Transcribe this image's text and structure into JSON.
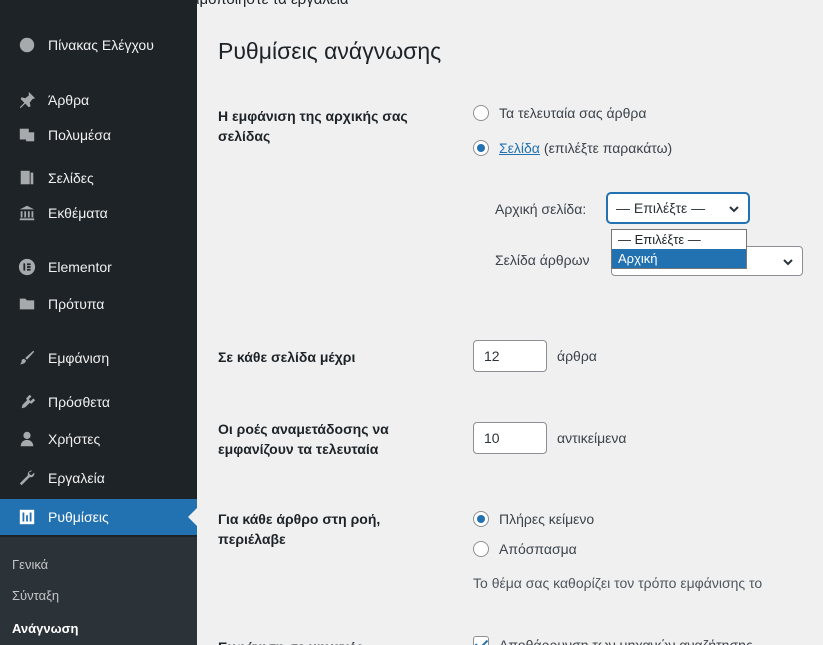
{
  "top_hint": "Χρησιμοποιήστε τα εργαλεία",
  "sidebar": {
    "items": [
      {
        "label": "Πίνακας Ελέγχου",
        "icon": "dashboard-icon"
      },
      {
        "label": "Άρθρα",
        "icon": "pin-icon"
      },
      {
        "label": "Πολυμέσα",
        "icon": "media-icon"
      },
      {
        "label": "Σελίδες",
        "icon": "page-icon"
      },
      {
        "label": "Εκθέματα",
        "icon": "bank-icon"
      },
      {
        "label": "Elementor",
        "icon": "elementor-icon"
      },
      {
        "label": "Πρότυπα",
        "icon": "folder-icon"
      },
      {
        "label": "Εμφάνιση",
        "icon": "brush-icon"
      },
      {
        "label": "Πρόσθετα",
        "icon": "plugin-icon"
      },
      {
        "label": "Χρήστες",
        "icon": "users-icon"
      },
      {
        "label": "Εργαλεία",
        "icon": "wrench-icon"
      },
      {
        "label": "Ρυθμίσεις",
        "icon": "settings-icon"
      }
    ],
    "submenu": [
      "Γενικά",
      "Σύνταξη",
      "Ανάγνωση"
    ]
  },
  "page": {
    "title": "Ρυθμίσεις ανάγνωσης",
    "homepage": {
      "label": "Η εμφάνιση της αρχικής σας σελίδας",
      "option_latest": "Τα τελευταία σας άρθρα",
      "option_page_link": "Σελίδα",
      "option_page_rest": "(επιλέξτε παρακάτω)",
      "front_label": "Αρχική σελίδα:",
      "front_value": "— Επιλέξτε —",
      "posts_label": "Σελίδα άρθρων",
      "dropdown_options": [
        "— Επιλέξτε —",
        "Αρχική"
      ]
    },
    "per_page": {
      "label": "Σε κάθε σελίδα μέχρι",
      "value": "12",
      "suffix": "άρθρα"
    },
    "feeds": {
      "label": "Οι ροές αναμετάδοσης να εμφανίζουν τα τελευταία",
      "value": "10",
      "suffix": "αντικείμενα"
    },
    "feed_content": {
      "label": "Για κάθε άρθρο στη ροή, περιέλαβε",
      "option_full": "Πλήρες κείμενο",
      "option_excerpt": "Απόσπασμα",
      "description": "Το θέμα σας καθορίζει τον τρόπο εμφάνισης το"
    },
    "search": {
      "label": "Εμφάνιση σε μηχανές",
      "checkbox_text": "Αποθάρρυνση των μηχανών αναζήτησης"
    }
  },
  "colors": {
    "sidebar": "#1d2327",
    "accent": "#2271b1",
    "background": "#f0f0f1"
  }
}
